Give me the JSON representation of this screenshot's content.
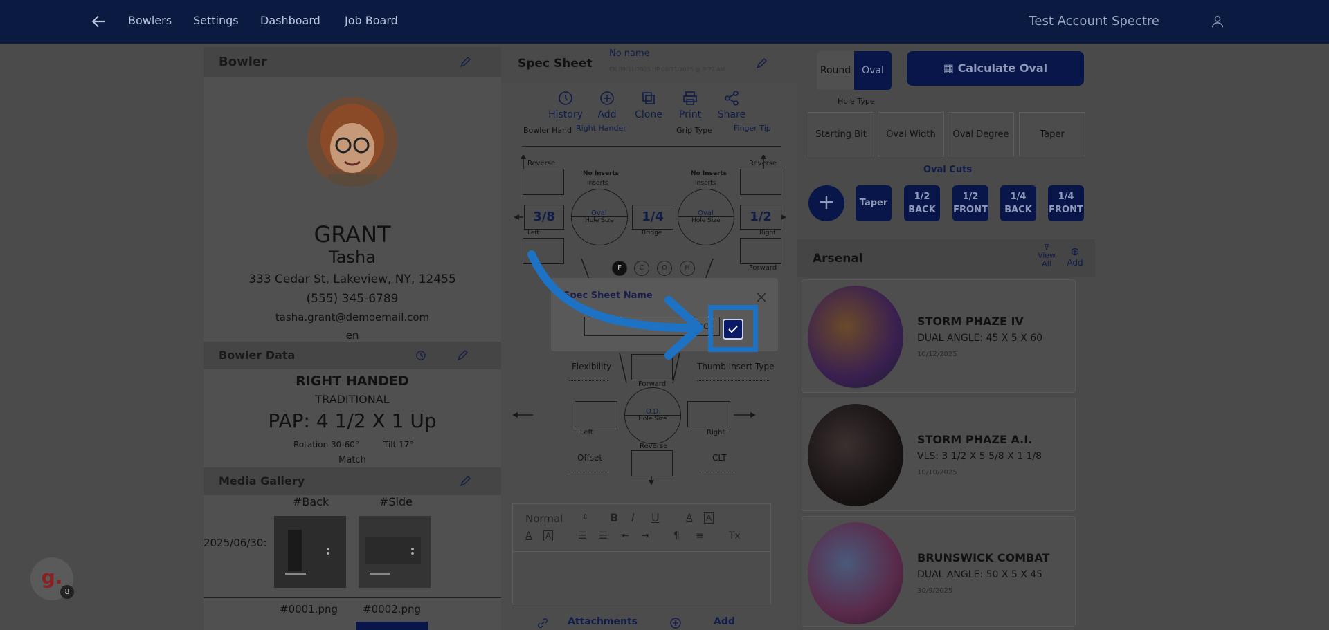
{
  "nav": {
    "links": [
      "Bowlers",
      "Settings",
      "Dashboard",
      "Job Board"
    ],
    "account": "Test Account Spectre"
  },
  "bowler": {
    "header": "Bowler",
    "last_name": "GRANT",
    "first_name": "Tasha",
    "address": "333 Cedar St, Lakeview, NY, 12455",
    "phone": "(555) 345-6789",
    "email": "tasha.grant@demoemail.com",
    "language": "en"
  },
  "bowler_data": {
    "header": "Bowler Data",
    "hand": "RIGHT HANDED",
    "style": "TRADITIONAL",
    "pap": "PAP: 4 1/2 X 1 Up",
    "rotation": "Rotation 30-60°",
    "tilt": "Tilt 17°",
    "match": "Match"
  },
  "media": {
    "header": "Media Gallery",
    "date_label": "2025/06/30:",
    "tags": [
      "#Back",
      "#Side"
    ],
    "files": [
      "#0001.png",
      "#0002.png"
    ]
  },
  "spec": {
    "header": "Spec Sheet",
    "name": "No name",
    "meta": "CR 09/11/2025 UP 09/11/2025 @ 9:22 AM",
    "toolbar": [
      "History",
      "Add",
      "Clone",
      "Print",
      "Share"
    ],
    "bowler_hand_label": "Bowler Hand",
    "bowler_hand_value": "Right Hander",
    "grip_type_label": "Grip Type",
    "grip_type_value": "Finger Tip",
    "reverse": "Reverse",
    "forward": "Forward",
    "left": "Left",
    "right": "Right",
    "bridge": "Bridge",
    "no_inserts": "No Inserts",
    "inserts": "Inserts",
    "oval": "Oval",
    "hole_size": "Hole Size",
    "od": "O.D.",
    "left_value": "3/8",
    "bridge_value": "1/4",
    "right_value": "1/2",
    "indicators": [
      "F",
      "C",
      "O",
      "H"
    ],
    "flexibility": "Flexibility",
    "thumb_insert_type": "Thumb Insert Type",
    "offset": "Offset",
    "clt": "CLT",
    "editor_format": "Normal",
    "attachments": "Attachments",
    "add": "Add"
  },
  "modal": {
    "title": "Spec Sheet Name",
    "input_value": "heet"
  },
  "hole": {
    "round": "Round",
    "oval": "Oval",
    "calculate": "Calculate Oval",
    "hole_type_label": "Hole Type",
    "columns": [
      "Starting Bit",
      "Oval Width",
      "Oval Degree",
      "Taper"
    ],
    "oval_cuts_label": "Oval Cuts",
    "cuts": [
      {
        "top": "Taper",
        "bottom": ""
      },
      {
        "top": "1/2",
        "bottom": "BACK"
      },
      {
        "top": "1/2",
        "bottom": "FRONT"
      },
      {
        "top": "1/4",
        "bottom": "BACK"
      },
      {
        "top": "1/4",
        "bottom": "FRONT"
      }
    ]
  },
  "arsenal": {
    "header": "Arsenal",
    "view_all": "View All",
    "add": "Add",
    "balls": [
      {
        "name": "STORM PHAZE IV",
        "layout": "DUAL ANGLE: 45 X 5 X 60",
        "date": "10/12/2025",
        "color": "#4a2a6a"
      },
      {
        "name": "STORM PHAZE A.I.",
        "layout": "VLS: 3 1/2 X 5 5/8 X 1 1/8",
        "date": "10/10/2025",
        "color": "#2a2222"
      },
      {
        "name": "BRUNSWICK COMBAT",
        "layout": "DUAL ANGLE: 50 X 5 X 45",
        "date": "30/9/2025",
        "color": "#5a2a4a"
      }
    ]
  },
  "badge": {
    "letter": "g.",
    "count": "8"
  },
  "colors": {
    "nav_bg": "#0a1a40",
    "accent": "#08164a",
    "highlight": "#1d72c4"
  }
}
